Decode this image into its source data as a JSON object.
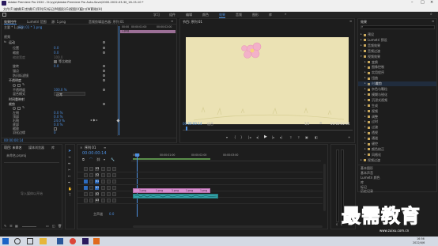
{
  "titlebar": {
    "title": "Adobe Premiere Pro 2020 - D:\\zyjx\\Adobe Premiere Pro Auto-Save\\2000-2022-03-30_16-15-10 *"
  },
  "menubar": {
    "items": [
      "文件(F)",
      "编辑(E)",
      "剪辑(C)",
      "序列(S)",
      "标记(M)",
      "图形(G)",
      "视图(V)",
      "窗口(W)",
      "帮助(H)"
    ]
  },
  "workspace_tabs": {
    "items": [
      "学习",
      "组件",
      "编辑",
      "颜色",
      "效果",
      "音频",
      "图形",
      "库"
    ],
    "active": "效果"
  },
  "effect_controls": {
    "tabs": [
      "效果控件",
      "Lumetri 范围",
      "源: 1.png",
      "音频剪辑混合器: 序列 01"
    ],
    "master": "主要 * 1.png",
    "clip": "序列 01 * 1.png",
    "section_video": "视频",
    "fx_motion": "运动",
    "position_label": "位置",
    "position_value": "0.0",
    "scale_label": "缩放",
    "scale_value": "0.0",
    "scale_width_label": "缩放宽度",
    "scale_width_value": "100.0",
    "uniform_scale_label": "等比缩放",
    "rotation_label": "旋转",
    "rotation_value": "0.0",
    "anchor_label": "锚点",
    "anti_flicker_label": "防闪烁滤镜",
    "opacity_label": "不透明度",
    "opacity_value": "100.0 %",
    "blend_label": "混合模式",
    "blend_value": "正常",
    "time_remap": "时间重映射",
    "crop_fx": "裁剪",
    "crop_items": [
      {
        "label": "左侧",
        "value": "0.0 %"
      },
      {
        "label": "顶部",
        "value": "0.0 %"
      },
      {
        "label": "右侧",
        "value": "24.0 %"
      },
      {
        "label": "底部",
        "value": "0.0 %"
      }
    ],
    "zoom_label": "缩放",
    "feather_label": "羽化边缘",
    "feather_value": "0",
    "crop_fx2": "裁剪",
    "crop2_items": [
      {
        "label": "左侧",
        "value": "0.0 %"
      },
      {
        "label": "顶部",
        "value": "0.0 %"
      },
      {
        "label": "右侧",
        "value": "0.0 %"
      },
      {
        "label": "底部",
        "value": "0.0 %"
      }
    ],
    "timecode": "00:00:00:14",
    "ruler": [
      "00:00",
      "00:00:01:00",
      "00:00:02:00"
    ]
  },
  "program_monitor": {
    "tab": "节目: 序列 01",
    "timecode_left": "00:00:00:14",
    "fit": "适合",
    "quality": "1/2",
    "timecode_right": "00:00:02:04"
  },
  "effects_panel": {
    "tab": "效果",
    "items": [
      "预设",
      "Lumetri 预设",
      "音频效果",
      "音频过渡",
      "视频效果",
      "变换",
      "图像控制",
      "实用程序",
      "扭曲",
      "时间",
      "杂色与颗粒",
      "模糊与锐化",
      "沉浸式视频",
      "生成",
      "视频",
      "调整",
      "过时",
      "过渡",
      "透视",
      "通道",
      "键控",
      "颜色校正",
      "风格化",
      "视频过渡"
    ],
    "highlight": "裁剪",
    "bottom": [
      "基本图形",
      "基本声音",
      "Lumetri 颜色",
      "库",
      "标记",
      "历史记录",
      "信息"
    ]
  },
  "project_panel": {
    "tabs": [
      "项目: 未命名",
      "媒体浏览器",
      "库"
    ],
    "project_name": "未命名.prproj",
    "import_hint": "导入媒体以开始"
  },
  "timeline": {
    "tab": "序列 01",
    "timecode": "00:00:00:14",
    "ruler": [
      "00:00",
      "00:00:01:00",
      "00:00:02:00",
      "00:00:03:00"
    ],
    "video_tracks": [
      "V3",
      "V2",
      "V1"
    ],
    "audio_tracks": [
      "A1",
      "A2",
      "A3"
    ],
    "master": "主声道",
    "master_value": "0.0",
    "clip_labels": [
      "1.png",
      "1.png",
      "1.png",
      "1.png",
      "1.png"
    ]
  },
  "taskbar": {
    "time": "16:56",
    "date": "2022/4/6"
  },
  "watermark": {
    "text": "最需教育",
    "url": "www.zuixu.com.cn"
  },
  "colors": {
    "accent_blue": "#2d6bbd",
    "clip_pink": "#d98fd0",
    "audio_teal": "#33a3a8",
    "monitor_bg": "#ebe2b4"
  }
}
